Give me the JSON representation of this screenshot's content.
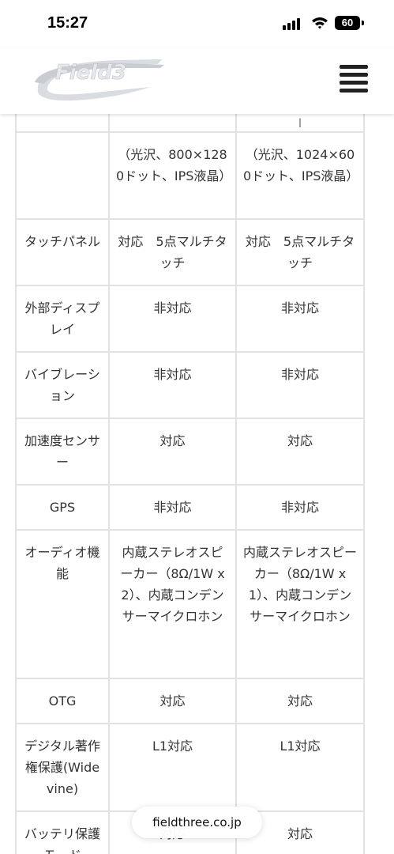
{
  "status_bar": {
    "time": "15:27",
    "battery": "60"
  },
  "header": {
    "logo_text": "Field3"
  },
  "footer": {
    "url": "fieldthree.co.jp"
  },
  "table": {
    "rows": [
      {
        "label": "",
        "col1": "",
        "col2": "I"
      },
      {
        "label": "",
        "col1": "（光沢、800×1280ドット、IPS液晶）",
        "col2": "（光沢、1024×600ドット、IPS液晶）"
      },
      {
        "label": "タッチパネル",
        "col1": "対応　5点マルチタッチ",
        "col2": "対応　5点マルチタッチ"
      },
      {
        "label": "外部ディスプレイ",
        "col1": "非対応",
        "col2": "非対応"
      },
      {
        "label": "バイブレーション",
        "col1": "非対応",
        "col2": "非対応"
      },
      {
        "label": "加速度センサー",
        "col1": "対応",
        "col2": "対応"
      },
      {
        "label": "GPS",
        "col1": "非対応",
        "col2": "非対応"
      },
      {
        "label": "オーディオ機能",
        "col1": "内蔵ステレオスピーカー（8Ω/1W x 2）、内蔵コンデンサーマイクロホン",
        "col2": "内蔵ステレオスピーカー（8Ω/1W x 1）、内蔵コンデンサーマイクロホン"
      },
      {
        "label": "OTG",
        "col1": "対応",
        "col2": "対応"
      },
      {
        "label": "デジタル著作権保護(Widevine)",
        "col1": "L1対応",
        "col2": "L1対応"
      },
      {
        "label": "バッテリ保護モード",
        "col1": "対応",
        "col2": "対応"
      }
    ]
  }
}
